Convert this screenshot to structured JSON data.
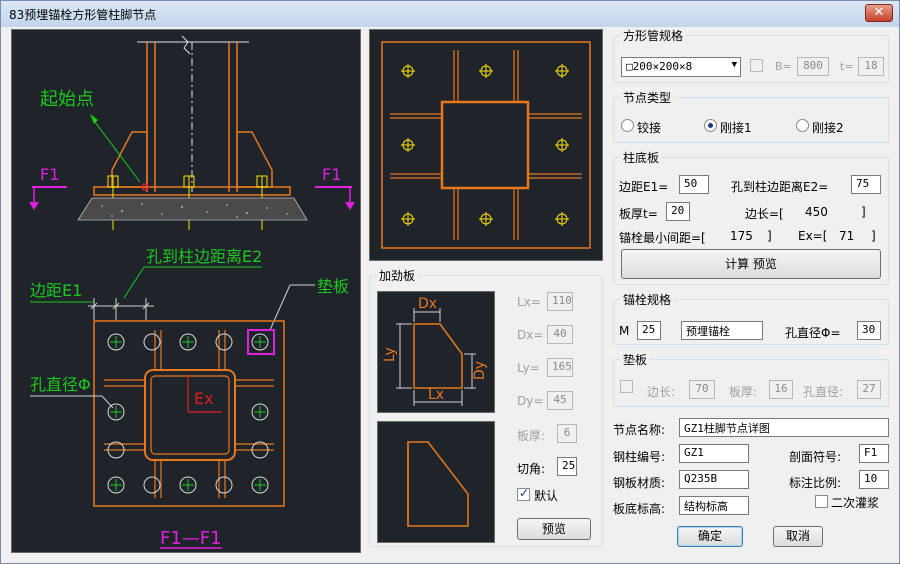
{
  "window": {
    "title": "83预埋锚栓方形管柱脚节点",
    "close_glyph": "✕"
  },
  "drawing": {
    "start_point_label": "起始点",
    "section_mark": "F1",
    "hole_edge_label": "孔到柱边距离E2",
    "edge_label": "边距E1",
    "pad_label": "垫板",
    "hole_dia_label": "孔直径Φ",
    "ex_label": "Ex",
    "section_title": "F1—F1"
  },
  "tube_spec": {
    "title": "方形管规格",
    "selected": "□200×200×8",
    "b_label": "B=",
    "b_value": "800",
    "t_label": "t=",
    "t_value": "18"
  },
  "node_type": {
    "title": "节点类型",
    "options": [
      "铰接",
      "刚接1",
      "刚接2"
    ],
    "selected_index": 1
  },
  "base_plate": {
    "title": "柱底板",
    "e1_label": "边距E1=",
    "e1_value": "50",
    "e2_label": "孔到柱边距离E2=",
    "e2_value": "75",
    "thick_label": "板厚t=",
    "thick_value": "20",
    "side_label": "边长=[",
    "side_value": "450",
    "bracket_close": "]",
    "min_space_label": "锚栓最小间距=[",
    "min_space_value": "175",
    "ex_label": "Ex=[",
    "ex_value": "71",
    "calc_button": "计算 预览"
  },
  "stiffener": {
    "title": "加劲板",
    "lx_label": "Lx=",
    "lx_value": "110",
    "dx_label": "Dx=",
    "dx_value": "40",
    "ly_label": "Ly=",
    "ly_value": "165",
    "dy_label": "Dy=",
    "dy_value": "45",
    "thick_label": "板厚:",
    "thick_value": "6",
    "chamfer_label": "切角:",
    "chamfer_value": "25",
    "default_label": "默认",
    "default_checked": true,
    "preview_button": "预览",
    "diagram_labels": {
      "dx": "Dx",
      "ly": "Ly",
      "dy": "Dy",
      "lx": "Lx"
    }
  },
  "anchor_spec": {
    "title": "锚栓规格",
    "m_label": "M",
    "m_value": "25",
    "type_value": "预埋锚栓",
    "hole_label": "孔直径Φ=",
    "hole_value": "30"
  },
  "pad": {
    "title": "垫板",
    "side_label": "边长:",
    "side_value": "70",
    "thick_label": "板厚:",
    "thick_value": "16",
    "hole_label": "孔直径:",
    "hole_value": "27"
  },
  "node_info": {
    "name_label": "节点名称:",
    "name_value": "GZ1柱脚节点详图",
    "col_label": "钢柱编号:",
    "col_value": "GZ1",
    "section_label": "剖面符号:",
    "section_value": "F1",
    "material_label": "钢板材质:",
    "material_value": "Q235B",
    "scale_label": "标注比例:",
    "scale_value": "10",
    "elev_label": "板底标高:",
    "elev_value": "结构标高",
    "grout_label": "二次灌浆"
  },
  "buttons": {
    "ok": "确定",
    "cancel": "取消"
  },
  "colors": {
    "orange": "#e8781c",
    "yellow": "#ffe000",
    "green": "#1cc81c",
    "magenta": "#e020e0",
    "cad_bg": "#1f232a"
  }
}
